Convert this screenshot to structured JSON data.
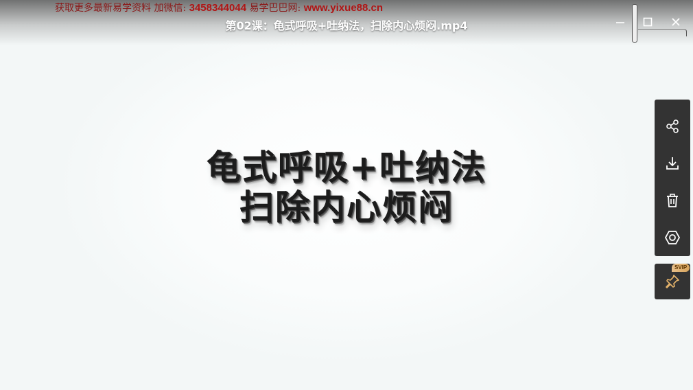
{
  "watermark": {
    "prefix": "获取更多最新易学资料  加微信: ",
    "wechat": "3458344044",
    "middle": " 易学巴巴网: ",
    "site": "www.yixue88.cn"
  },
  "window": {
    "title": "第02课：龟式呼吸+吐纳法，扫除内心烦闷.mp4",
    "controls": [
      "minimize-icon",
      "maximize-icon",
      "close-icon"
    ]
  },
  "slide": {
    "line1": "龟式呼吸+吐纳法",
    "line2": "扫除内心烦闷"
  },
  "side_toolbar": {
    "items": [
      "share-icon",
      "download-icon",
      "delete-icon",
      "settings-icon"
    ]
  },
  "pin": {
    "icon": "pin-icon",
    "badge": "SVIP"
  },
  "colors": {
    "panel": "#333333",
    "watermark": "#8b1a1a",
    "badge": "#d7a45c",
    "pin": "#e3b26a"
  }
}
